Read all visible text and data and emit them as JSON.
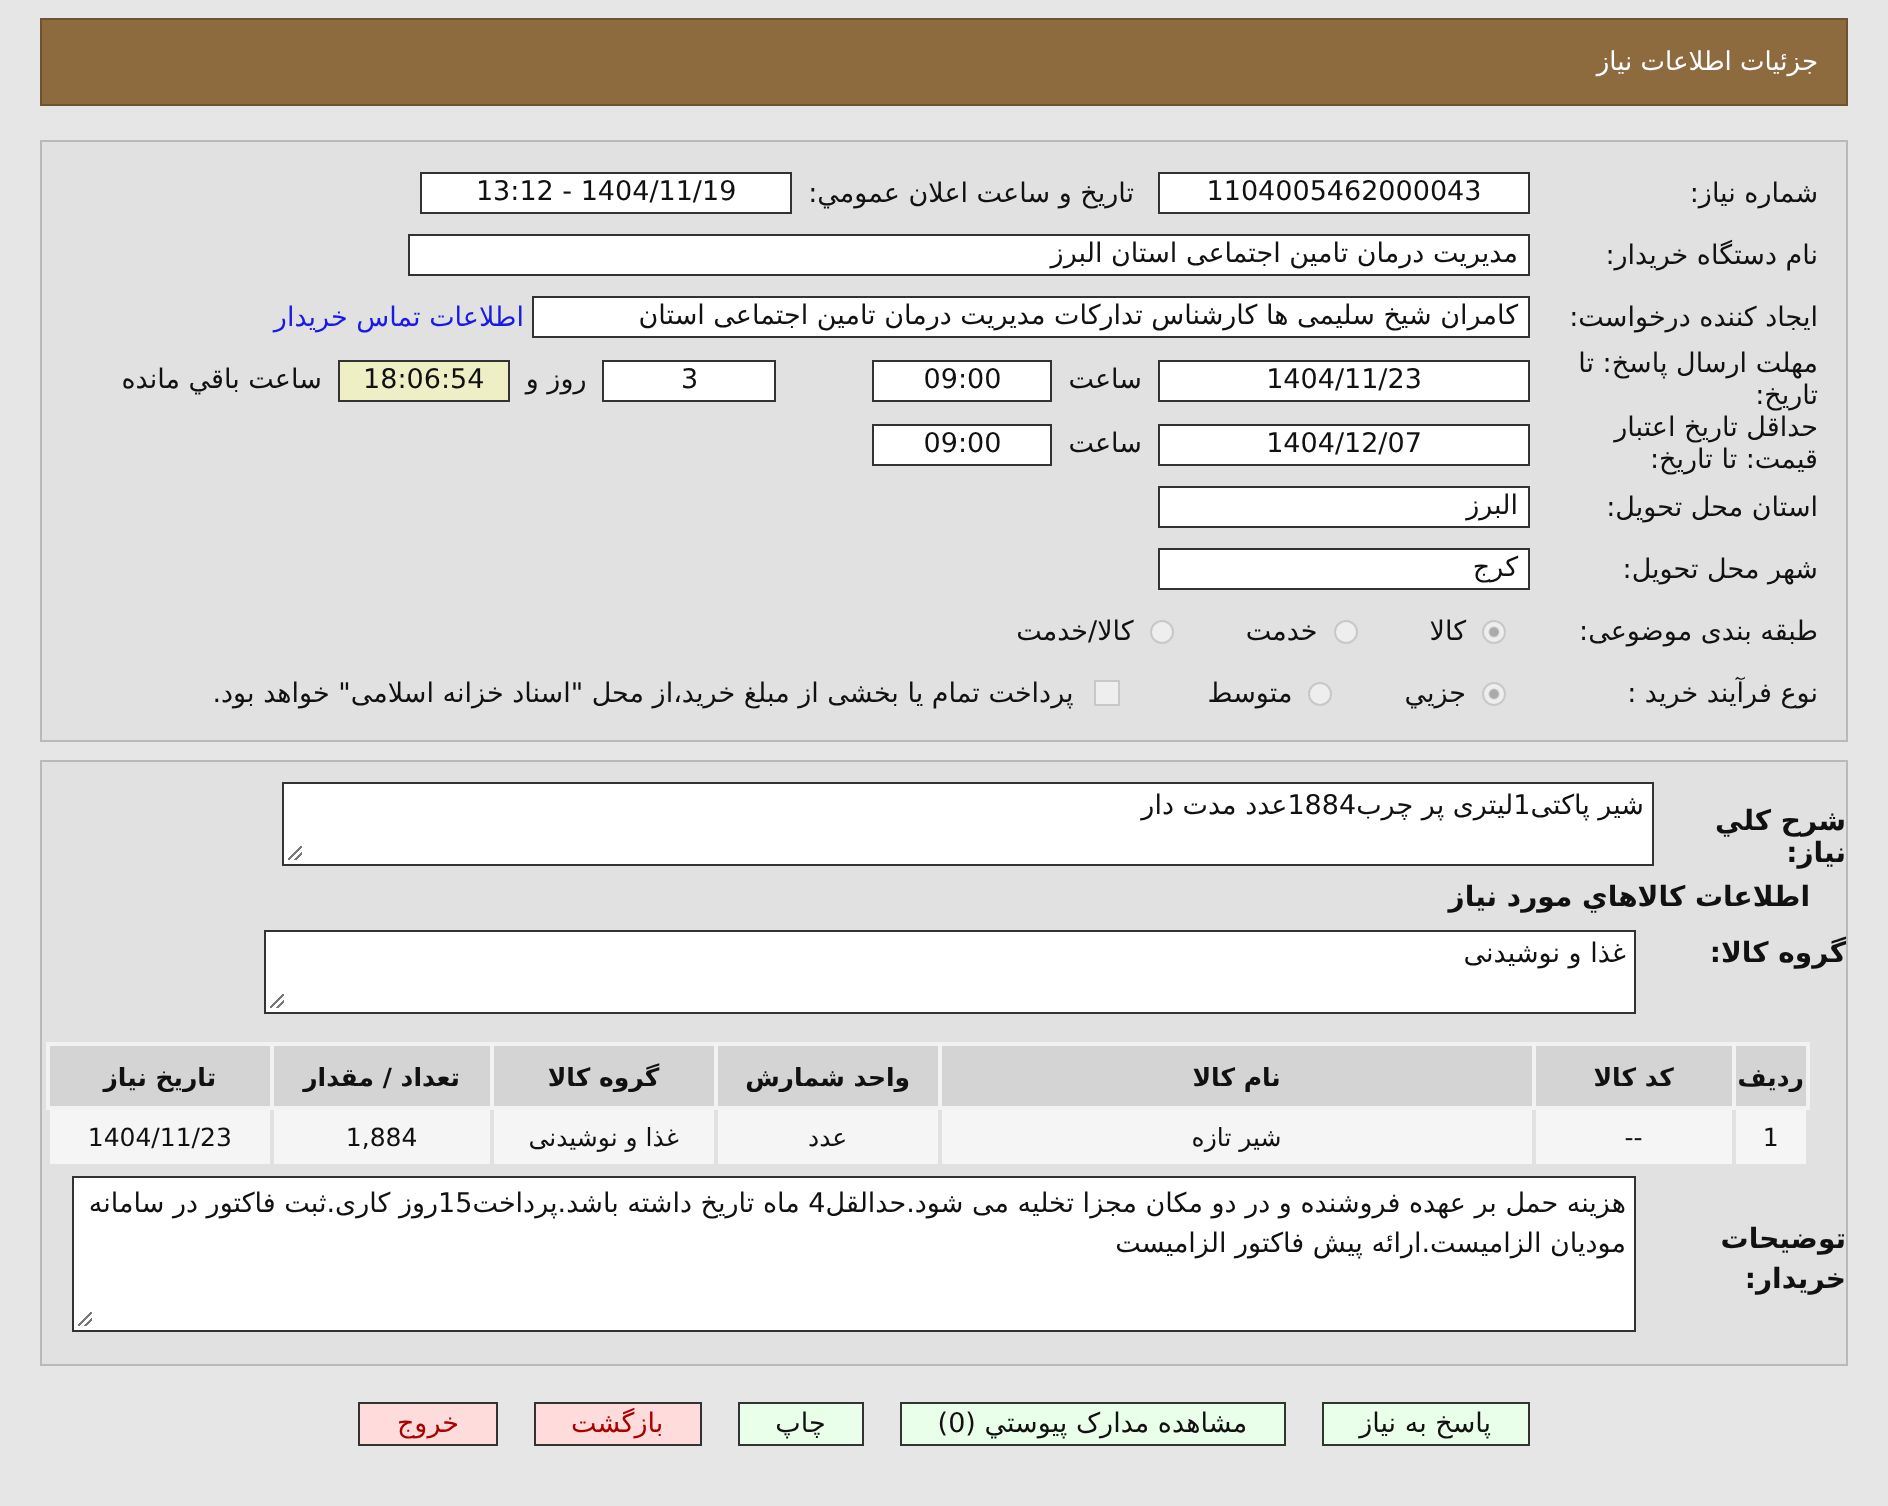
{
  "header": {
    "title": "جزئیات اطلاعات نیاز"
  },
  "need_number": {
    "label": "شماره نیاز:",
    "value": "1104005462000043"
  },
  "announce": {
    "label": "تاریخ و ساعت اعلان عمومي:",
    "value": "1404/11/19 - 13:12"
  },
  "buyer_org": {
    "label": "نام دستگاه خریدار:",
    "value": "مدیریت درمان تامین اجتماعی استان البرز"
  },
  "requester": {
    "label": "ایجاد کننده درخواست:",
    "value": "کامران شیخ سلیمی ها کارشناس تدارکات مدیریت درمان تامین اجتماعی استان",
    "link": "اطلاعات تماس خريدار"
  },
  "deadline": {
    "label": "مهلت ارسال پاسخ: تا تاریخ:",
    "date": "1404/11/23",
    "time_label": "ساعت",
    "time": "09:00",
    "days": "3",
    "days_label": "روز و",
    "remaining": "18:06:54",
    "remaining_label": "ساعت باقي مانده"
  },
  "validity": {
    "label": "حداقل تاریخ اعتبار قیمت: تا تاریخ:",
    "date": "1404/12/07",
    "time_label": "ساعت",
    "time": "09:00"
  },
  "province": {
    "label": "استان محل تحویل:",
    "value": "البرز"
  },
  "city": {
    "label": "شهر محل تحویل:",
    "value": "کرج"
  },
  "category": {
    "label": "طبقه بندی موضوعی:",
    "options": [
      {
        "label": "کالا",
        "selected": true
      },
      {
        "label": "خدمت",
        "selected": false
      },
      {
        "label": "کالا/خدمت",
        "selected": false
      }
    ]
  },
  "process": {
    "label": "نوع فرآیند خرید :",
    "options": [
      {
        "label": "جزيي",
        "selected": true
      },
      {
        "label": "متوسط",
        "selected": false
      }
    ],
    "treasury": {
      "checked": false,
      "label": "پرداخت تمام یا بخشی از مبلغ خرید،از محل \"اسناد خزانه اسلامی\" خواهد بود."
    }
  },
  "description": {
    "label": "شرح کلي نياز:",
    "value": "شیر پاکتی1لیتری پر چرب1884عدد مدت دار"
  },
  "goods_title": "اطلاعات کالاهاي مورد نياز",
  "goods_group": {
    "label": "گروه کالا:",
    "value": "غذا و نوشیدنی"
  },
  "table": {
    "columns": [
      "رديف",
      "کد کالا",
      "نام کالا",
      "واحد شمارش",
      "گروه کالا",
      "تعداد / مقدار",
      "تاریخ نیاز"
    ],
    "rows": [
      [
        "1",
        "--",
        "شير تازه",
        "عدد",
        "غذا و نوشیدنی",
        "1,884",
        "1404/11/23"
      ]
    ]
  },
  "notes": {
    "label": "توضیحات خریدار:",
    "value": "هزینه حمل بر عهده فروشنده و در دو مکان مجزا تخلیه می شود.حدالقل4 ماه تاریخ داشته باشد.پرداخت15روز کاری.ثبت فاکتور در سامانه مودیان الزامیست.ارائه پیش فاکتور الزامیست"
  },
  "buttons": [
    {
      "label": "پاسخ به نياز",
      "kind": "normal"
    },
    {
      "label": "مشاهده مدارک پيوستي (0)",
      "kind": "normal"
    },
    {
      "label": "چاپ",
      "kind": "normal"
    },
    {
      "label": "بازگشت",
      "kind": "danger"
    },
    {
      "label": "خروج",
      "kind": "danger"
    }
  ]
}
